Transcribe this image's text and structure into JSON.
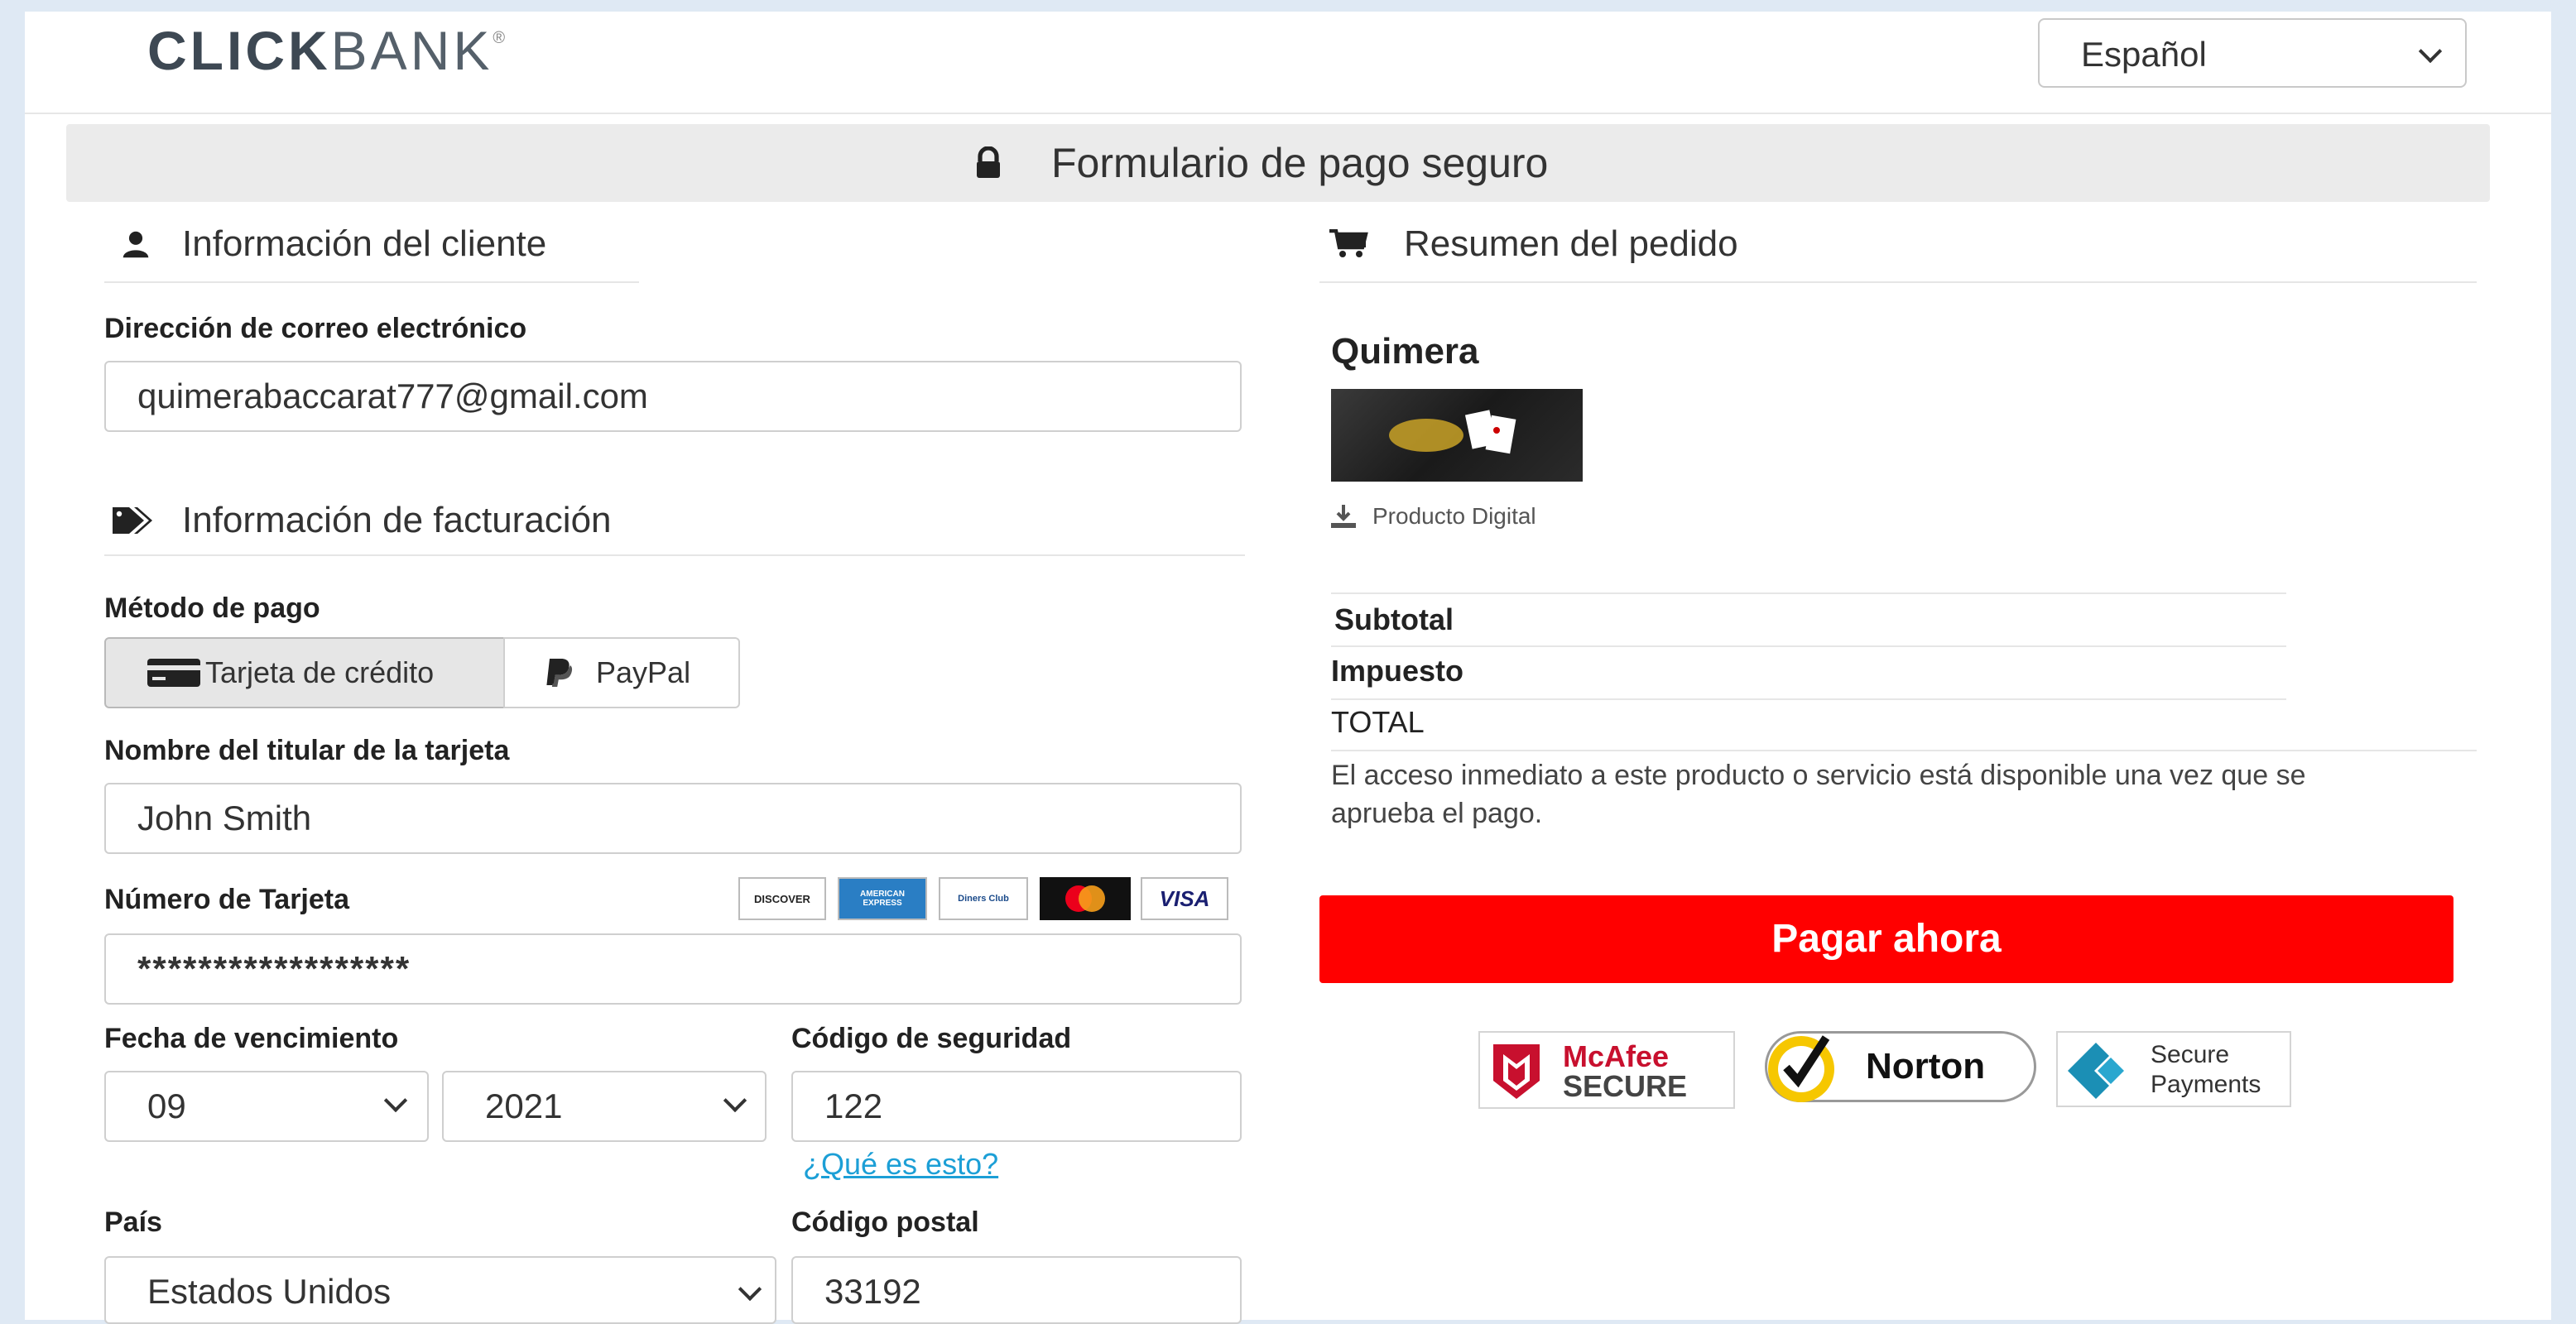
{
  "header": {
    "logo_bold": "CLICK",
    "logo_light": "BANK",
    "logo_reg": "®",
    "language": "Español"
  },
  "banner": {
    "title": "Formulario de pago seguro"
  },
  "customer": {
    "heading": "Información del cliente",
    "email_label": "Dirección de correo electrónico",
    "email_value": "quimerabaccarat777@gmail.com"
  },
  "billing": {
    "heading": "Información de facturación",
    "method_label": "Método de pago",
    "method_card": "Tarjeta de crédito",
    "method_paypal": "PayPal",
    "holder_label": "Nombre del titular de la tarjeta",
    "holder_value": "John Smith",
    "card_label": "Número de Tarjeta",
    "card_value": "******************",
    "expiry_label": "Fecha de vencimiento",
    "expiry_month": "09",
    "expiry_year": "2021",
    "cvv_label": "Código de seguridad",
    "cvv_value": "122",
    "cvv_help": "¿Qué es esto?",
    "country_label": "País",
    "country_value": "Estados Unidos",
    "zip_label": "Código postal",
    "zip_value": "33192",
    "card_brands": [
      "DISCOVER",
      "AMERICAN EXPRESS",
      "Diners Club",
      "mastercard",
      "VISA"
    ]
  },
  "order": {
    "heading": "Resumen del pedido",
    "product_name": "Quimera",
    "product_type": "Producto Digital",
    "subtotal": "Subtotal",
    "tax": "Impuesto",
    "total": "TOTAL",
    "note": "El acceso inmediato a este producto o servicio está disponible una vez que se aprueba el pago.",
    "pay_button": "Pagar ahora"
  },
  "trust": {
    "mcafee_top": "McAfee",
    "mcafee_bottom": "SECURE",
    "norton": "Norton",
    "secure_top": "Secure",
    "secure_bottom": "Payments"
  },
  "colors": {
    "pay_button": "#ff0000",
    "link": "#1c9fd6",
    "norton_yellow": "#f6c700",
    "mcafee_red": "#c8102e"
  }
}
